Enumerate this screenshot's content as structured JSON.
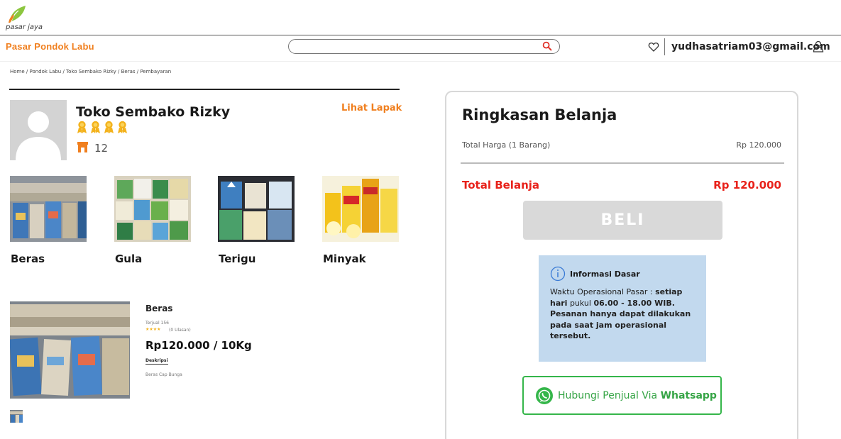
{
  "brand": {
    "logo_text": "pasar jaya"
  },
  "header": {
    "market_name": "Pasar Pondok Labu",
    "search_placeholder": "",
    "user_email": "yudhasatriam03@gmail.com"
  },
  "breadcrumb": "Home / Pondok Labu / Toko Sembako Rizky / Beras / Pembayaran",
  "store": {
    "name": "Toko Sembako Rizky",
    "medal_count": 4,
    "count": "12",
    "view_store_label": "Lihat Lapak"
  },
  "categories": [
    {
      "label": "Beras"
    },
    {
      "label": "Gula"
    },
    {
      "label": "Terigu"
    },
    {
      "label": "Minyak"
    }
  ],
  "product": {
    "name": "Beras",
    "sold": "Terjual 156",
    "stars": "★★★★",
    "reviews": "(0 Ulasan)",
    "price": "Rp120.000 / 10Kg",
    "desc_label": "Deskripsi",
    "desc": "Beras Cap Bunga"
  },
  "summary": {
    "title": "Ringkasan Belanja",
    "price_label": "Total Harga (1 Barang)",
    "price_value": "Rp 120.000",
    "total_label": "Total Belanja",
    "total_value": "Rp 120.000",
    "buy_label": "BELI",
    "info": {
      "title": "Informasi Dasar",
      "line1_a": "Waktu Operasional Pasar : ",
      "line1_b": "setiap hari",
      "line1_c": " pukul ",
      "line1_d": "06.00 - 18.00 WIB.",
      "line2": "Pesanan hanya dapat dilakukan pada saat jam operasional tersebut."
    },
    "whatsapp": {
      "prefix": "Hubungi Penjual Via ",
      "app": "Whatsapp"
    }
  },
  "colors": {
    "accent_orange": "#f07f1e",
    "total_red": "#e8221b",
    "whatsapp_green": "#35b64a",
    "info_bg": "#c2d9ee",
    "buy_disabled": "#d9d9d9"
  }
}
